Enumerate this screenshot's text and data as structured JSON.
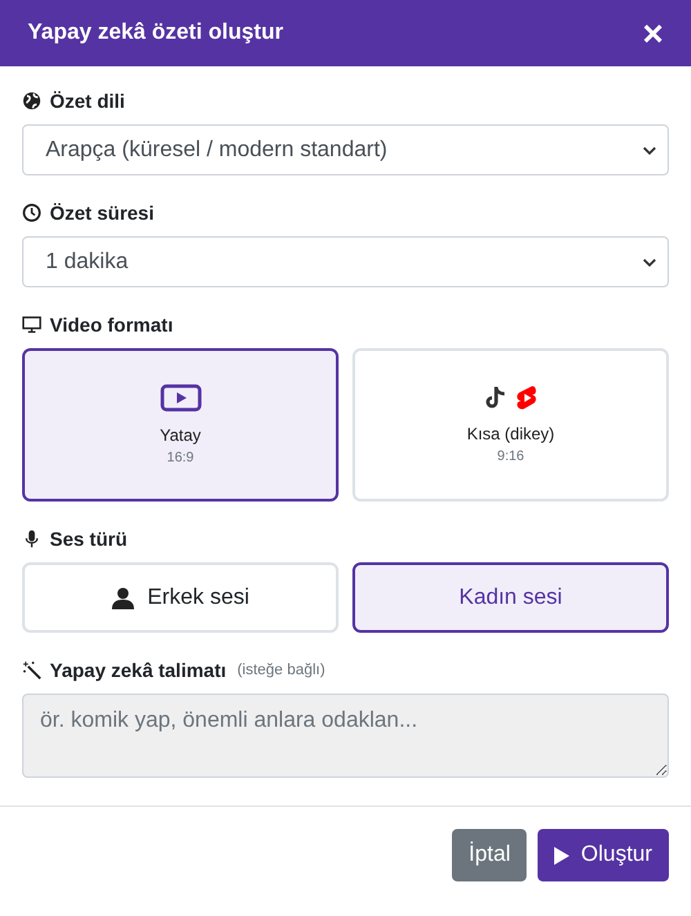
{
  "window": {
    "title": "Yapay zekâ özeti oluştur",
    "close": "×"
  },
  "sections": [
    {
      "kind": "select",
      "label": "Özet dili",
      "value": "Arapça (küresel / modern standart)"
    },
    {
      "kind": "select",
      "label": "Özet süresi",
      "value": "1 dakika"
    },
    {
      "kind": "cards",
      "label": "Video formatı",
      "options": [
        {
          "title": "Yatay",
          "ratio": "16:9",
          "selected": true
        },
        {
          "title": "Kısa (dikey)",
          "ratio": "9:16",
          "selected": false
        }
      ]
    },
    {
      "kind": "toggle",
      "label": "Ses türü",
      "options": [
        {
          "title": "Erkek sesi",
          "selected": false
        },
        {
          "title": "Kadın sesi",
          "selected": true
        }
      ]
    },
    {
      "kind": "textarea",
      "label": "Yapay zekâ talimatı",
      "hint": "(isteğe bağlı)",
      "placeholder": "ör. komik yap, önemli anlara odaklan..."
    }
  ],
  "buttons": [
    {
      "kind": "secondary",
      "label": "İptal"
    },
    {
      "kind": "primary",
      "label": "Oluştur"
    }
  ]
}
